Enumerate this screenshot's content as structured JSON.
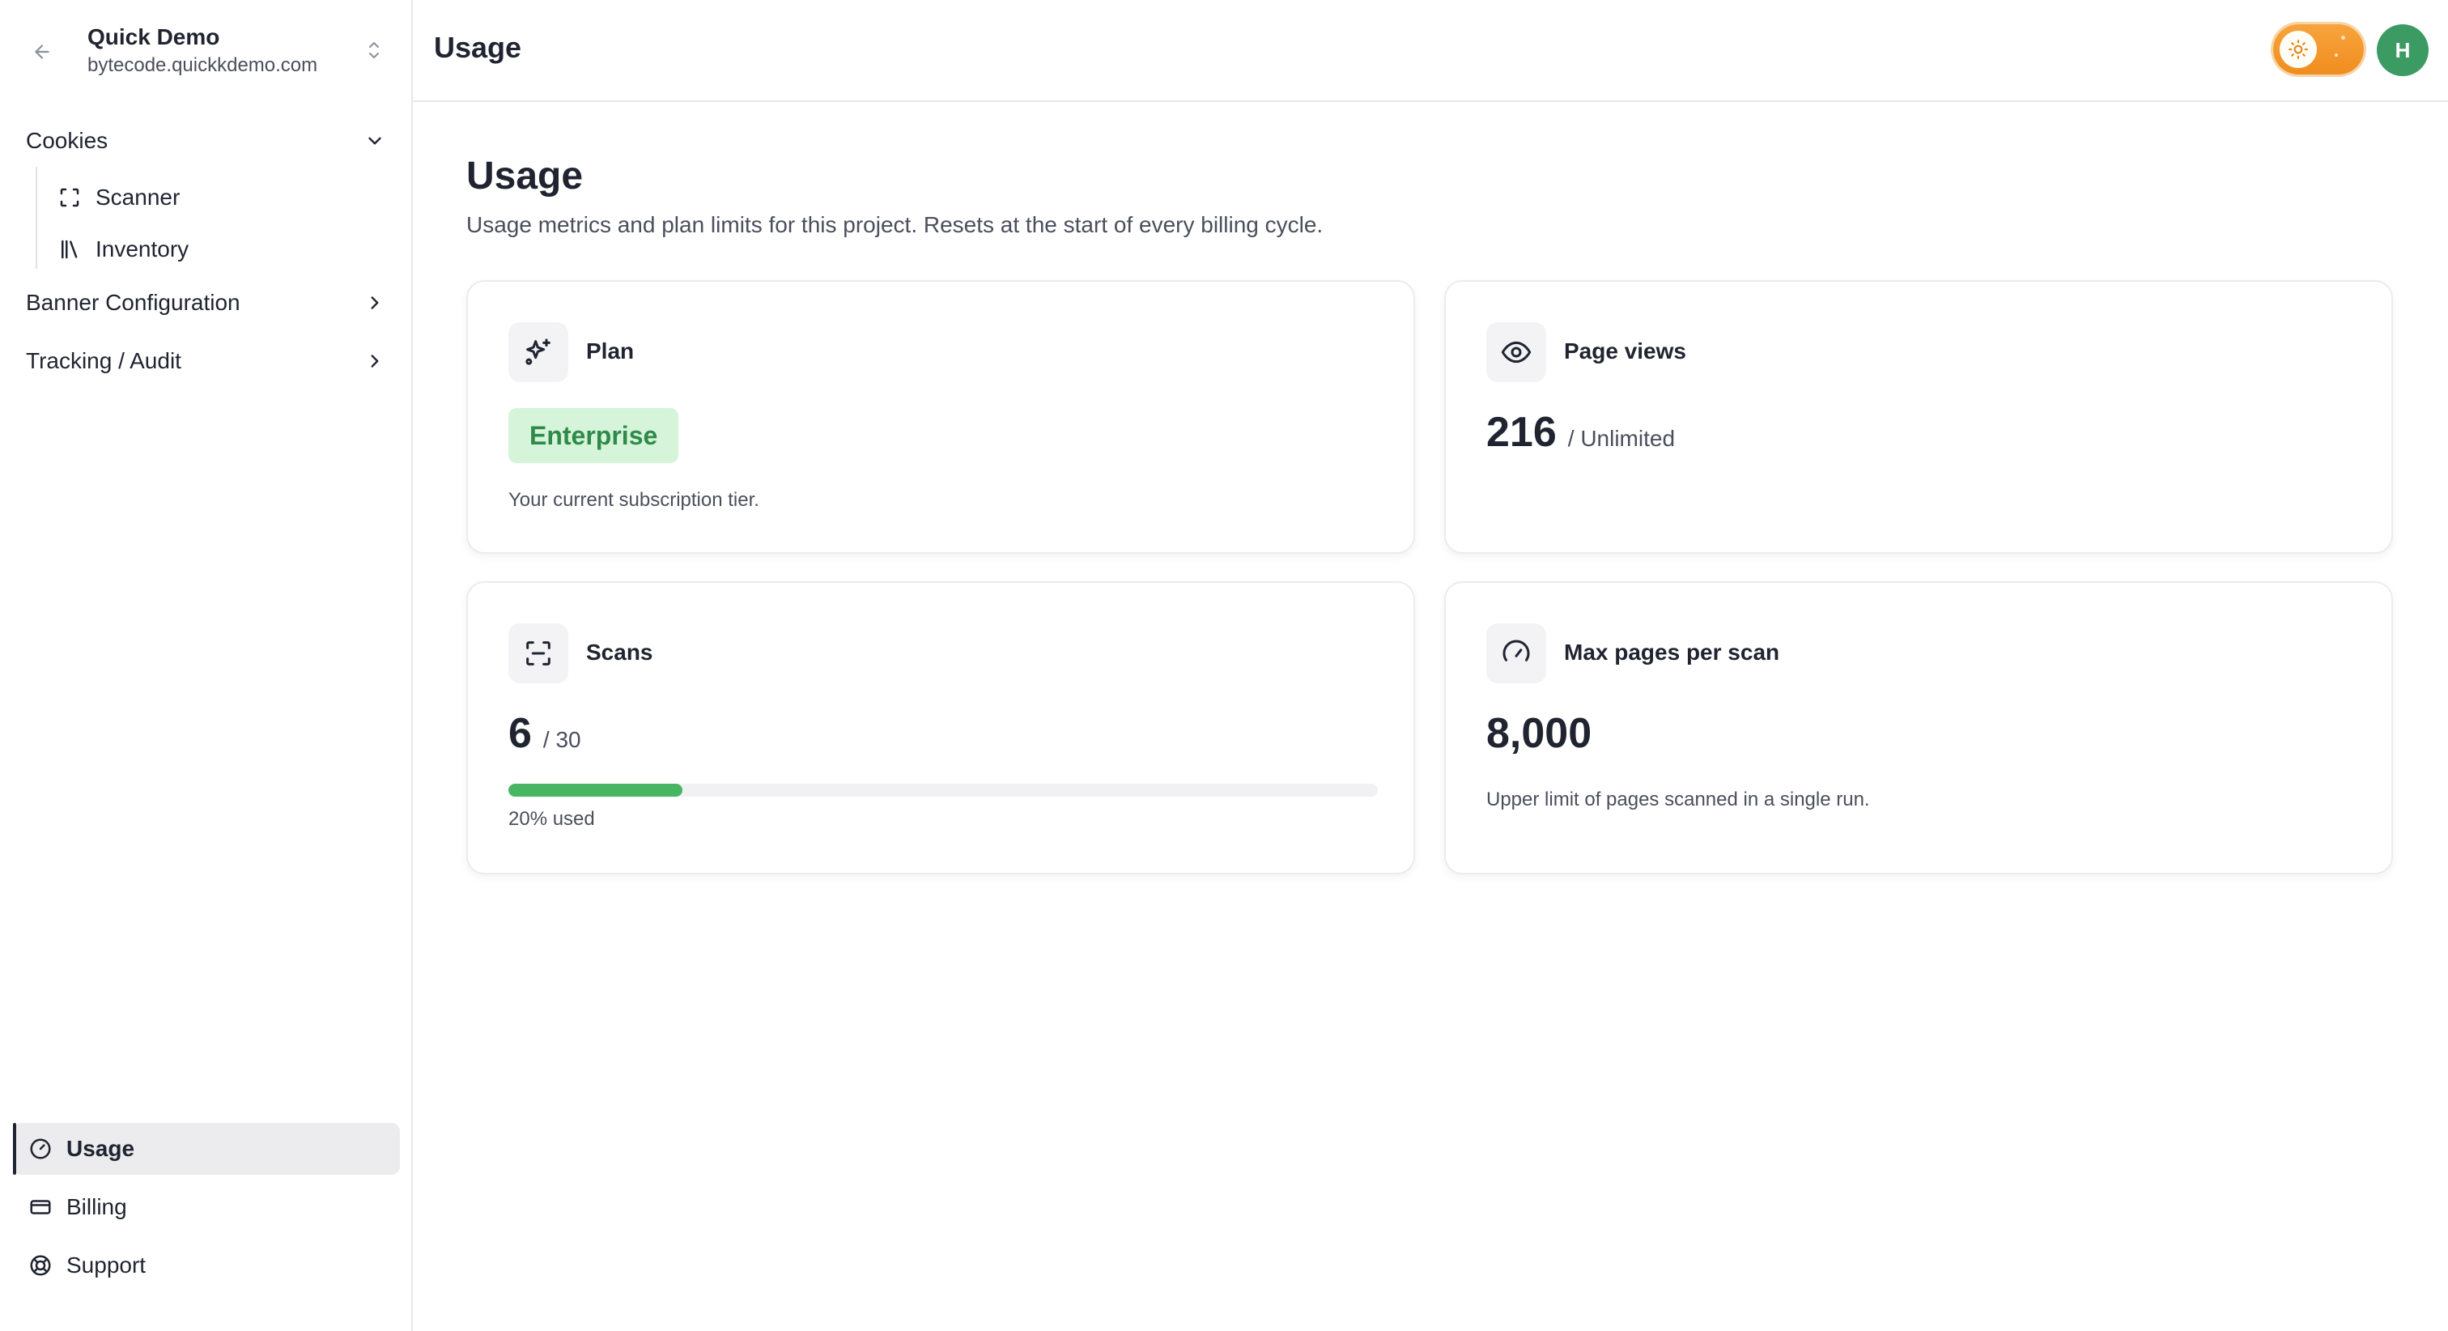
{
  "sidebar": {
    "project": {
      "name": "Quick Demo",
      "domain": "bytecode.quickkdemo.com"
    },
    "groups": [
      {
        "label": "Cookies",
        "expanded": true,
        "icon": "chevron-down-icon"
      },
      {
        "label": "Banner Configuration",
        "expanded": false,
        "icon": "chevron-right-icon"
      },
      {
        "label": "Tracking / Audit",
        "expanded": false,
        "icon": "chevron-right-icon"
      }
    ],
    "cookies_items": [
      {
        "label": "Scanner",
        "icon": "scan-frame-icon"
      },
      {
        "label": "Inventory",
        "icon": "library-icon"
      }
    ],
    "bottom_items": [
      {
        "label": "Usage",
        "icon": "gauge-icon",
        "active": true
      },
      {
        "label": "Billing",
        "icon": "credit-card-icon",
        "active": false
      },
      {
        "label": "Support",
        "icon": "lifebuoy-icon",
        "active": false
      }
    ]
  },
  "header": {
    "title": "Usage",
    "avatar_initial": "H",
    "theme": "light"
  },
  "page": {
    "heading": "Usage",
    "subtitle": "Usage metrics and plan limits for this project. Resets at the start of every billing cycle."
  },
  "cards": {
    "plan": {
      "title": "Plan",
      "icon": "sparkles-icon",
      "badge": "Enterprise",
      "note": "Your current subscription tier."
    },
    "page_views": {
      "title": "Page views",
      "icon": "eye-icon",
      "value": "216",
      "limit": "/ Unlimited"
    },
    "scans": {
      "title": "Scans",
      "icon": "scan-icon",
      "value": "6",
      "limit": "/ 30",
      "progress": 0.2,
      "usage_text": "20% used"
    },
    "max_pages": {
      "title": "Max pages per scan",
      "icon": "gauge-icon",
      "value": "8,000",
      "note": "Upper limit of pages scanned in a single run."
    }
  },
  "colors": {
    "accent_green": "#48b562",
    "badge_bg": "#d5f4d9",
    "badge_text": "#2f8a4a",
    "avatar_bg": "#3b9b63",
    "toggle_orange": "#f29a2e"
  }
}
